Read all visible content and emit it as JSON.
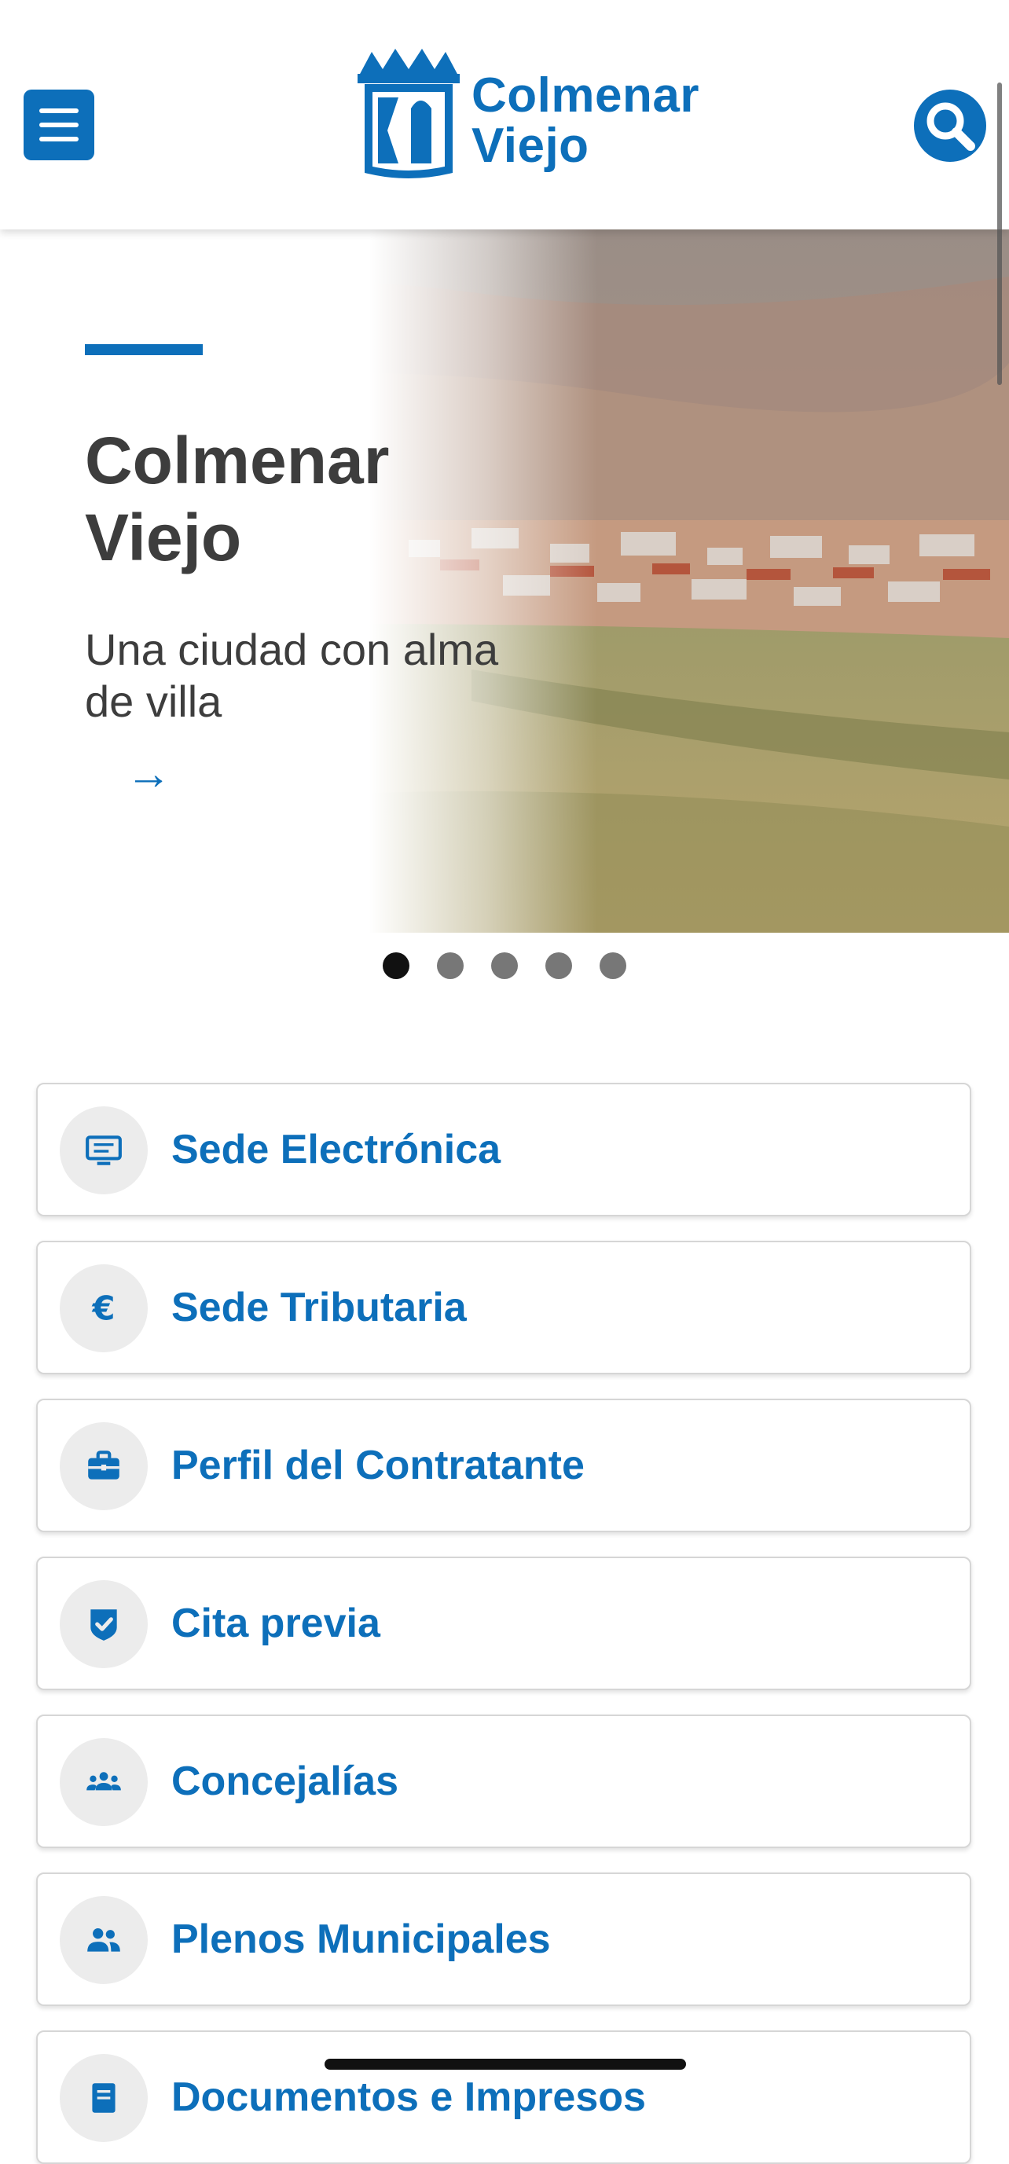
{
  "header": {
    "menu_icon": "hamburger-icon",
    "logo_line1": "Colmenar",
    "logo_line2": "Viejo",
    "search_icon": "search-icon",
    "brand_color": "#0d6fba"
  },
  "hero": {
    "title": "Colmenar Viejo",
    "subtitle": "Una ciudad con alma de villa",
    "arrow": "→",
    "slide_count": 5,
    "active_slide": 1
  },
  "links": [
    {
      "label": "Sede Electrónica",
      "icon": "computer-icon"
    },
    {
      "label": "Sede Tributaria",
      "icon": "euro-icon"
    },
    {
      "label": "Perfil del Contratante",
      "icon": "briefcase-icon"
    },
    {
      "label": "Cita previa",
      "icon": "checkmark-shield-icon"
    },
    {
      "label": "Concejalías",
      "icon": "group-icon"
    },
    {
      "label": "Plenos Municipales",
      "icon": "people-icon"
    },
    {
      "label": "Documentos e Impresos",
      "icon": "document-icon"
    }
  ]
}
